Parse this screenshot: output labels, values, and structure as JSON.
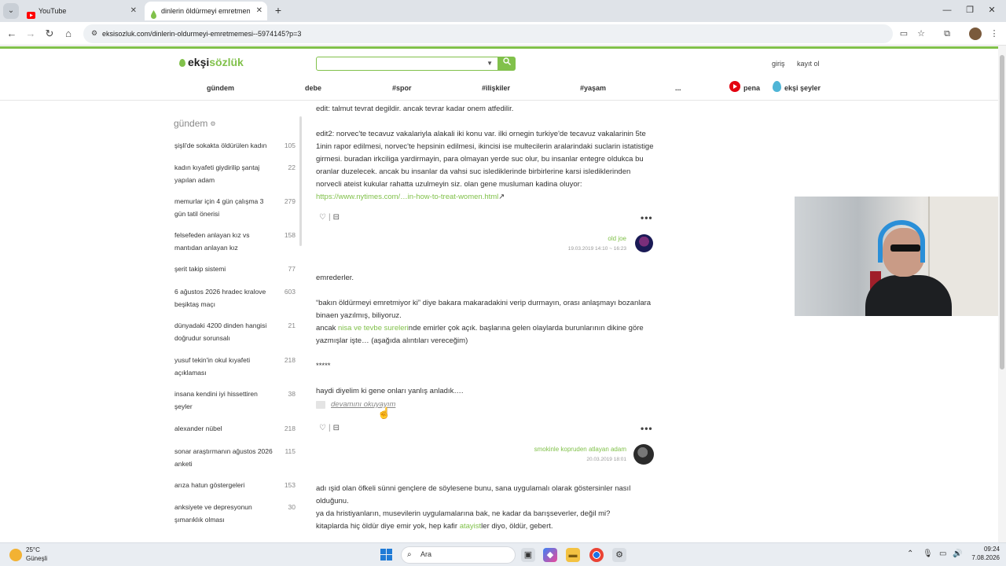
{
  "browser": {
    "tabs": [
      {
        "title": "YouTube",
        "active": false
      },
      {
        "title": "dinlerin öldürmeyi emretmemesi",
        "active": true
      }
    ],
    "url": "eksisozluk.com/dinlerin-oldurmeyi-emretmemesi--5974145?p=3"
  },
  "site": {
    "logo_prefix": "ekşi",
    "logo_suffix": "sözlük",
    "search_placeholder": "",
    "login": "giriş",
    "register": "kayıt ol",
    "nav": [
      "gündem",
      "debe",
      "#spor",
      "#ilişkiler",
      "#yaşam",
      "..."
    ],
    "pena": "pena",
    "eksi_seyler": "ekşi şeyler"
  },
  "sidebar": {
    "title": "gündem",
    "items": [
      {
        "label": "şişli'de sokakta öldürülen kadın",
        "count": "105"
      },
      {
        "label": "kadın kıyafeti giydirilip şantaj yapılan adam",
        "count": "22"
      },
      {
        "label": "memurlar için 4 gün çalışma 3 gün tatil önerisi",
        "count": "279"
      },
      {
        "label": "felsefeden anlayan kız vs mantıdan anlayan kız",
        "count": "158"
      },
      {
        "label": "şerit takip sistemi",
        "count": "77"
      },
      {
        "label": "6 ağustos 2026 hradec kralove beşiktaş maçı",
        "count": "603"
      },
      {
        "label": "dünyadaki 4200 dinden hangisi doğrudur sorunsalı",
        "count": "21"
      },
      {
        "label": "yusuf tekin'in okul kıyafeti açıklaması",
        "count": "218"
      },
      {
        "label": "insana kendini iyi hissettiren şeyler",
        "count": "38"
      },
      {
        "label": "alexander nübel",
        "count": "218"
      },
      {
        "label": "sonar araştırmanın ağustos 2026 anketi",
        "count": "115"
      },
      {
        "label": "arıza hatun göstergeleri",
        "count": "153"
      },
      {
        "label": "anksiyete ve depresyonun şımarıklık olması",
        "count": "30"
      }
    ]
  },
  "entries": [
    {
      "p1": "edit: talmut tevrat degildir. ancak tevrar kadar onem atfedilir.",
      "p2": "edit2: norvec'te tecavuz vakalariyla alakali iki konu var. ilki ornegin turkiye'de tecavuz vakalarinin 5te 1inin rapor edilmesi, norvec'te hepsinin edilmesi, ikincisi ise multecilerin aralarindaki suclarin istatistige girmesi. buradan irkciliga yardirmayin, para olmayan yerde suc olur, bu insanlar entegre oldukca bu oranlar duzelecek. ancak bu insanlar da vahsi suc islediklerinde birbirlerine karsi islediklerinden norvecli ateist kukular rahatta uzulmeyin siz. olan gene musluman kadina oluyor:",
      "link": "https://www.nytimes.com/…in-how-to-treat-women.html",
      "author": "old joe",
      "date": "19.03.2019 14:10 ~ 16:23"
    },
    {
      "p1": "emrederler.",
      "p2": "“bakın öldürmeyi emretmiyor ki” diye bakara makaradakini verip durmayın, orası anlaşmayı bozanlara binaen yazılmış, biliyoruz.",
      "p3_pre": "ancak ",
      "p3_link": "nisa ve tevbe sureleri",
      "p3_post": "nde emirler çok açık. başlarına gelen olaylarda burunlarının dikine göre yazmışlar işte… (aşağıda alıntıları vereceğim)",
      "stars": "*****",
      "p4": "haydi diyelim ki gene onları yanlış anladık….",
      "readmore": "devamını okuyayım",
      "author": "smokinle kopruden atlayan adam",
      "date": "20.03.2019 18:01"
    },
    {
      "p1": "adı ışid olan öfkeli sünni gençlere de söylesene bunu, sana uygulamalı olarak göstersinler nasıl olduğunu.",
      "p2": "ya da hristiyanların, musevilerin uygulamalarına bak, ne kadar da barışseverler, değil mi?",
      "p3_pre": "kitaplarda hiç öldür diye emir yok, hep kafir ",
      "p3_link": "atayist",
      "p3_post": "ler diyo, öldür, gebert."
    }
  ],
  "taskbar": {
    "temp": "25°C",
    "weather": "Güneşli",
    "search": "Ara",
    "time": "09:24",
    "date": "7.08.2026"
  },
  "colors": {
    "brand": "#81c14b",
    "pena": "#e3000f"
  }
}
